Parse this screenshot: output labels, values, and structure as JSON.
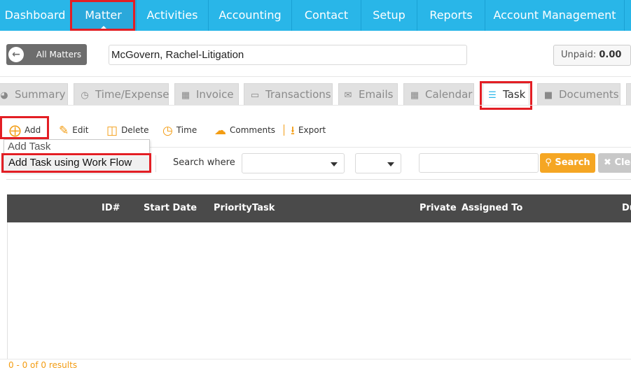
{
  "nav": {
    "items": [
      {
        "label": "Dashboard"
      },
      {
        "label": "Matter"
      },
      {
        "label": "Activities"
      },
      {
        "label": "Accounting"
      },
      {
        "label": "Contact"
      },
      {
        "label": "Setup"
      },
      {
        "label": "Reports"
      },
      {
        "label": "Account Management"
      }
    ],
    "active": "Matter"
  },
  "matter_bar": {
    "all_matters_label": "All Matters",
    "matter_name": "McGovern, Rachel-Litigation",
    "unpaid_label": "Unpaid:",
    "unpaid_value": "0.00"
  },
  "tabs": [
    {
      "label": "Summary",
      "icon": "dashboard-icon"
    },
    {
      "label": "Time/Expense",
      "icon": "clock-icon"
    },
    {
      "label": "Invoice",
      "icon": "calculator-icon"
    },
    {
      "label": "Transactions",
      "icon": "credit-card-icon"
    },
    {
      "label": "Emails",
      "icon": "envelope-icon"
    },
    {
      "label": "Calendar",
      "icon": "calendar-icon"
    },
    {
      "label": "Task",
      "icon": "tasks-icon",
      "active": true
    },
    {
      "label": "Documents",
      "icon": "folder-icon"
    }
  ],
  "toolbar": {
    "add": "Add",
    "edit": "Edit",
    "delete": "Delete",
    "time": "Time",
    "comments": "Comments",
    "export": "Export"
  },
  "add_menu": {
    "items": [
      "Add Task",
      "Add Task using Work Flow"
    ]
  },
  "filter": {
    "search_where_label": "Search where",
    "search_button": "Search",
    "clear_button": "Clear"
  },
  "grid": {
    "columns": [
      "ID#",
      "Start Date",
      "Priority",
      "Task",
      "Private",
      "Assigned To",
      "Du"
    ]
  },
  "footer": {
    "results_text": "0 - 0 of 0 results"
  },
  "colors": {
    "nav_bg": "#29b6e8",
    "accent_orange": "#f5a623",
    "highlight_red": "#e31e24",
    "grid_header": "#4a4a4a"
  }
}
